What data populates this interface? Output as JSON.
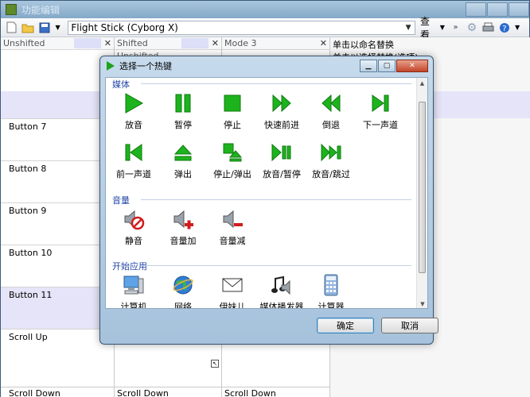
{
  "window": {
    "title": "功能编辑"
  },
  "toolbar": {
    "profile": "Flight Stick (Cyborg X)",
    "view_label": "查看"
  },
  "grid": {
    "columns": [
      {
        "label": "Unshifted",
        "sub": ""
      },
      {
        "label": "Shifted",
        "sub": "Unshifted"
      },
      {
        "label": "Mode 3",
        "sub": ""
      }
    ],
    "right_col_lines": [
      "单击以命名替换",
      "单击以选择替换(选项)"
    ],
    "rows": [
      "Button 7",
      "Button 8",
      "Button 9",
      "Button 10",
      "Button 11",
      "Scroll Up"
    ],
    "bottom_cells": [
      "Scroll Down",
      "Scroll Down",
      "Scroll Down"
    ]
  },
  "dialog": {
    "title": "选择一个热键",
    "sections": [
      {
        "title": "媒体",
        "rows": [
          [
            {
              "label": "放音",
              "icon": "play-icon"
            },
            {
              "label": "暂停",
              "icon": "pause-icon"
            },
            {
              "label": "停止",
              "icon": "stop-icon"
            },
            {
              "label": "快速前进",
              "icon": "fast-forward-icon"
            },
            {
              "label": "倒退",
              "icon": "rewind-icon"
            },
            {
              "label": "下一声道",
              "icon": "next-track-icon"
            }
          ],
          [
            {
              "label": "前一声道",
              "icon": "previous-track-icon"
            },
            {
              "label": "弹出",
              "icon": "eject-icon"
            },
            {
              "label": "停止/弹出",
              "icon": "stop-eject-icon"
            },
            {
              "label": "放音/暂停",
              "icon": "play-pause-icon"
            },
            {
              "label": "放音/跳过",
              "icon": "play-skip-icon"
            }
          ]
        ]
      },
      {
        "title": "音量",
        "rows": [
          [
            {
              "label": "静音",
              "icon": "mute-icon"
            },
            {
              "label": "音量加",
              "icon": "volume-up-icon"
            },
            {
              "label": "音量减",
              "icon": "volume-down-icon"
            }
          ]
        ]
      },
      {
        "title": "开始应用",
        "rows": [
          [
            {
              "label": "计算机",
              "icon": "computer-icon"
            },
            {
              "label": "网络",
              "icon": "network-icon"
            },
            {
              "label": "伊妹儿",
              "icon": "email-icon"
            },
            {
              "label": "媒体播发器",
              "icon": "media-player-icon"
            },
            {
              "label": "计算器",
              "icon": "calculator-icon"
            }
          ]
        ]
      }
    ],
    "ok_label": "确定",
    "cancel_label": "取消"
  },
  "colors": {
    "media_green": "#1db31d",
    "section_blue": "#2446a8"
  }
}
